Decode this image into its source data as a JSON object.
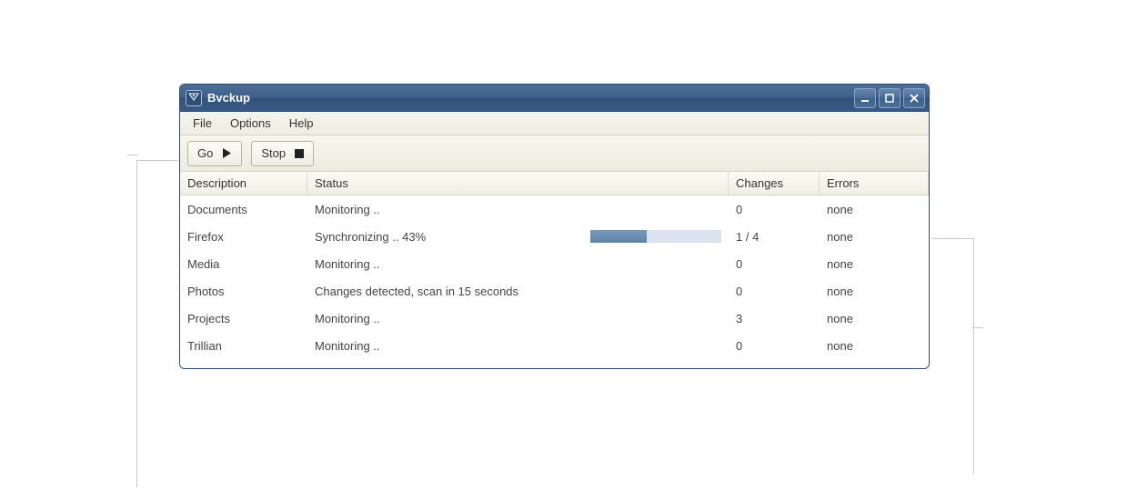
{
  "window": {
    "title": "Bvckup",
    "controls": {
      "minimize": "minimize",
      "maximize": "maximize",
      "close": "close"
    }
  },
  "menu": {
    "file": "File",
    "options": "Options",
    "help": "Help"
  },
  "toolbar": {
    "go": "Go",
    "stop": "Stop"
  },
  "columns": {
    "description": "Description",
    "status": "Status",
    "changes": "Changes",
    "errors": "Errors"
  },
  "rows": [
    {
      "description": "Documents",
      "status": "Monitoring ..",
      "progress": null,
      "changes": "0",
      "errors": "none"
    },
    {
      "description": "Firefox",
      "status": "Synchronizing ..  43%",
      "progress": 43,
      "changes": "1 / 4",
      "errors": "none"
    },
    {
      "description": "Media",
      "status": "Monitoring ..",
      "progress": null,
      "changes": "0",
      "errors": "none"
    },
    {
      "description": "Photos",
      "status": "Changes detected, scan in 15 seconds",
      "progress": null,
      "changes": "0",
      "errors": "none"
    },
    {
      "description": "Projects",
      "status": "Monitoring ..",
      "progress": null,
      "changes": "3",
      "errors": "none"
    },
    {
      "description": "Trillian",
      "status": "Monitoring ..",
      "progress": null,
      "changes": "0",
      "errors": "none"
    }
  ]
}
